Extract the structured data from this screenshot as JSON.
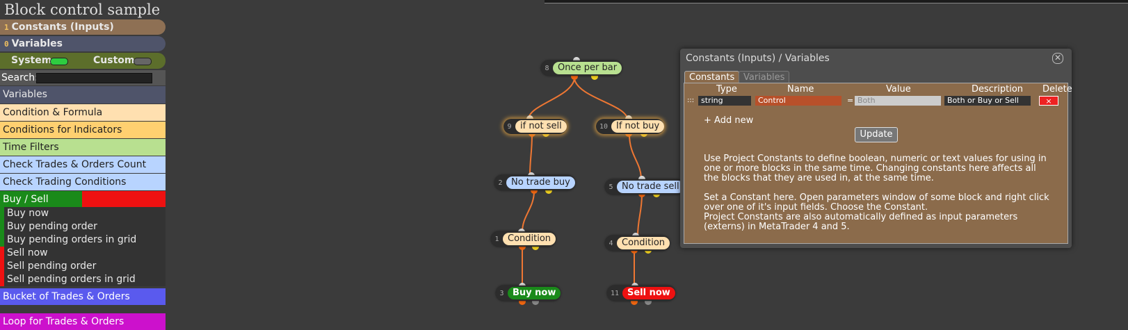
{
  "sidebar": {
    "title": "Block control sample",
    "constants": {
      "count": "1",
      "label": "Constants (Inputs)"
    },
    "variables": {
      "count": "0",
      "label": "Variables"
    },
    "system_label": "System",
    "custom_label": "Custom",
    "search_label": "Search:",
    "search_value": "",
    "categories": [
      {
        "label": "Variables",
        "color": "#4f546a"
      },
      {
        "label": "Condition & Formula",
        "color": "#ffe0b0"
      },
      {
        "label": "Conditions for Indicators",
        "color": "#ffd070"
      },
      {
        "label": "Time Filters",
        "color": "#b8e090"
      },
      {
        "label": "Check Trades & Orders Count",
        "color": "#b8d4ff"
      },
      {
        "label": "Check Trading Conditions",
        "color": "#b8d4ff"
      }
    ],
    "buy_sell_label": "Buy / Sell",
    "buy_items": [
      "Buy now",
      "Buy pending order",
      "Buy pending orders in grid"
    ],
    "sell_items": [
      "Sell now",
      "Sell pending order",
      "Sell pending orders in grid"
    ],
    "bucket_label": "Bucket of Trades & Orders",
    "loop_label": "Loop for Trades & Orders"
  },
  "canvas": {
    "nodes": [
      {
        "id": "8",
        "label": "Once per bar",
        "color": "#b8e090"
      },
      {
        "id": "9",
        "label": "if not sell",
        "color": "#ffe0b0"
      },
      {
        "id": "10",
        "label": "If not buy",
        "color": "#ffe0b0"
      },
      {
        "id": "2",
        "label": "No trade buy",
        "color": "#b8d4ff"
      },
      {
        "id": "5",
        "label": "No trade sell",
        "color": "#b8d4ff"
      },
      {
        "id": "1",
        "label": "Condition",
        "color": "#ffe0b0"
      },
      {
        "id": "4",
        "label": "Condition",
        "color": "#ffe0b0"
      },
      {
        "id": "3",
        "label": "Buy now",
        "color": "#1a8a1a"
      },
      {
        "id": "11",
        "label": "Sell now",
        "color": "#ee1111"
      }
    ]
  },
  "dialog": {
    "title": "Constants (Inputs) / Variables",
    "tabs": [
      "Constants",
      "Variables"
    ],
    "headers": {
      "type": "Type",
      "name": "Name",
      "value": "Value",
      "description": "Description",
      "delete": "Delete"
    },
    "row": {
      "handle": ":::",
      "type": "string",
      "name": "Control",
      "eq": "=",
      "value": "Both",
      "description": "Both or Buy or Sell",
      "delete": "×"
    },
    "add_new": "+ Add new",
    "update": "Update",
    "help_p1": "Use Project Constants to define boolean, numeric or text values for using in one or more blocks in the same time. Changing constants here affects all the blocks that they are used in, at the same time.",
    "help_p2": "Set a Constant here. Open parameters window of some block and right click over one of it's input fields. Choose the Constant.",
    "help_p3": "Project Constants are also automatically defined as input parameters (externs) in MetaTrader 4 and 5."
  }
}
